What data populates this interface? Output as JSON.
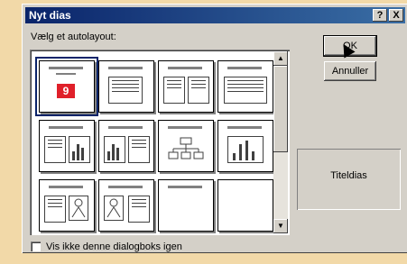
{
  "dialog": {
    "title": "Nyt dias",
    "help_button": "?",
    "close_button": "X",
    "layout_label": "Vælg et autolayout:",
    "ok_label": "OK",
    "cancel_label": "Annuller",
    "preview_label": "Titeldias",
    "checkbox_label": "Vis ikke denne dialogboks igen",
    "selected_badge": "9"
  },
  "layouts": [
    {
      "id": "title-slide",
      "selected": true
    },
    {
      "id": "bulleted-list"
    },
    {
      "id": "two-column-text"
    },
    {
      "id": "table"
    },
    {
      "id": "text-and-chart"
    },
    {
      "id": "chart-and-text"
    },
    {
      "id": "organization-chart"
    },
    {
      "id": "chart"
    },
    {
      "id": "text-and-clip-art"
    },
    {
      "id": "clip-art-and-text"
    },
    {
      "id": "title-only"
    },
    {
      "id": "blank"
    }
  ]
}
